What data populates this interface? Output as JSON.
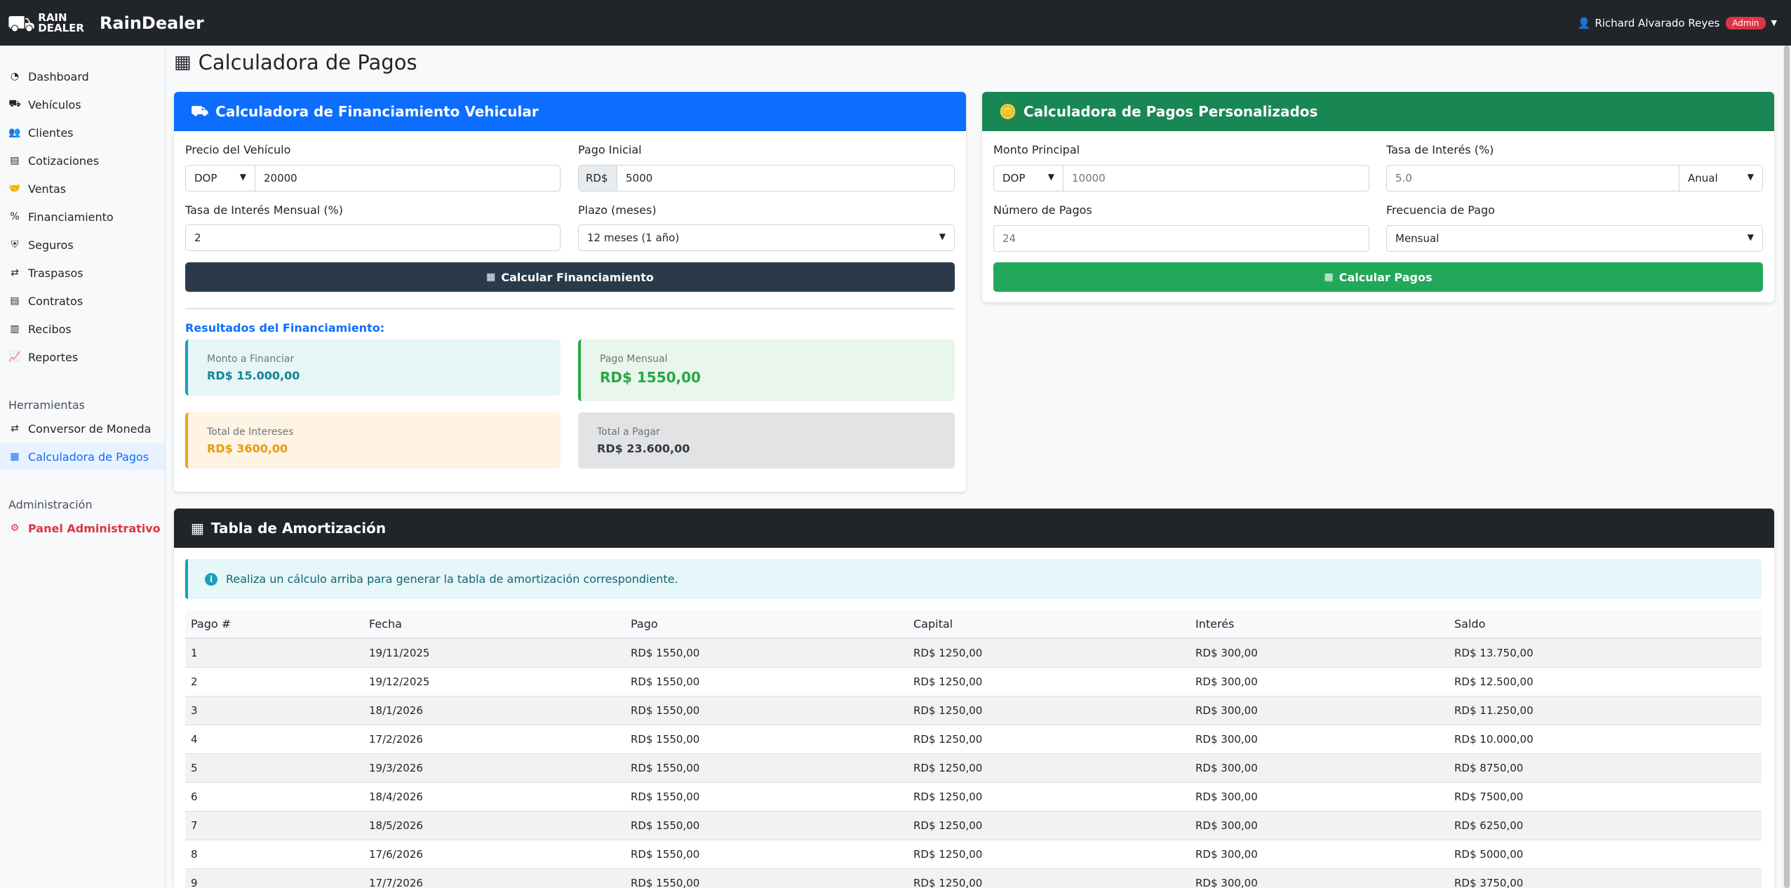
{
  "brand": {
    "logo_line1": "RAIN",
    "logo_line2": "DEALER",
    "name": "RainDealer"
  },
  "user": {
    "name": "Richard Alvarado Reyes",
    "badge": "Admin"
  },
  "sidebar": {
    "items": [
      {
        "label": "Dashboard",
        "icon": "gauge-icon"
      },
      {
        "label": "Vehículos",
        "icon": "car-icon"
      },
      {
        "label": "Clientes",
        "icon": "users-icon"
      },
      {
        "label": "Cotizaciones",
        "icon": "file-invoice-icon"
      },
      {
        "label": "Ventas",
        "icon": "handshake-icon"
      },
      {
        "label": "Financiamiento",
        "icon": "percent-icon"
      },
      {
        "label": "Seguros",
        "icon": "shield-icon"
      },
      {
        "label": "Traspasos",
        "icon": "exchange-icon"
      },
      {
        "label": "Contratos",
        "icon": "file-contract-icon"
      },
      {
        "label": "Recibos",
        "icon": "receipt-icon"
      },
      {
        "label": "Reportes",
        "icon": "chart-line-icon"
      }
    ],
    "tools_title": "Herramientas",
    "tools": [
      {
        "label": "Conversor de Moneda",
        "icon": "exchange-icon"
      },
      {
        "label": "Calculadora de Pagos",
        "icon": "calculator-icon"
      }
    ],
    "admin_title": "Administración",
    "admin": {
      "label": "Panel Administrativo",
      "icon": "user-gear-icon"
    }
  },
  "page": {
    "title": "Calculadora de Pagos"
  },
  "vehicle_calc": {
    "header": "Calculadora de Financiamiento Vehicular",
    "price_label": "Precio del Vehículo",
    "currency": "DOP",
    "price_value": "20000",
    "down_label": "Pago Inicial",
    "down_addon": "RD$",
    "down_value": "5000",
    "rate_label": "Tasa de Interés Mensual (%)",
    "rate_value": "2",
    "term_label": "Plazo (meses)",
    "term_value": "12 meses (1 año)",
    "button": "Calcular Financiamiento",
    "results_title": "Resultados del Financiamiento:",
    "results": {
      "amount_label": "Monto a Financiar",
      "amount_value": "RD$ 15.000,00",
      "monthly_label": "Pago Mensual",
      "monthly_value": "RD$ 1550,00",
      "interest_label": "Total de Intereses",
      "interest_value": "RD$ 3600,00",
      "total_label": "Total a Pagar",
      "total_value": "RD$ 23.600,00"
    }
  },
  "custom_calc": {
    "header": "Calculadora de Pagos Personalizados",
    "principal_label": "Monto Principal",
    "currency": "DOP",
    "principal_placeholder": "10000",
    "rate_label": "Tasa de Interés (%)",
    "rate_placeholder": "5.0",
    "rate_period": "Anual",
    "num_label": "Número de Pagos",
    "num_placeholder": "24",
    "freq_label": "Frecuencia de Pago",
    "freq_value": "Mensual",
    "button": "Calcular Pagos"
  },
  "amortization": {
    "header": "Tabla de Amortización",
    "alert": "Realiza un cálculo arriba para generar la tabla de amortización correspondiente.",
    "columns": [
      "Pago #",
      "Fecha",
      "Pago",
      "Capital",
      "Interés",
      "Saldo"
    ],
    "rows": [
      [
        "1",
        "19/11/2025",
        "RD$ 1550,00",
        "RD$ 1250,00",
        "RD$ 300,00",
        "RD$ 13.750,00"
      ],
      [
        "2",
        "19/12/2025",
        "RD$ 1550,00",
        "RD$ 1250,00",
        "RD$ 300,00",
        "RD$ 12.500,00"
      ],
      [
        "3",
        "18/1/2026",
        "RD$ 1550,00",
        "RD$ 1250,00",
        "RD$ 300,00",
        "RD$ 11.250,00"
      ],
      [
        "4",
        "17/2/2026",
        "RD$ 1550,00",
        "RD$ 1250,00",
        "RD$ 300,00",
        "RD$ 10.000,00"
      ],
      [
        "5",
        "19/3/2026",
        "RD$ 1550,00",
        "RD$ 1250,00",
        "RD$ 300,00",
        "RD$ 8750,00"
      ],
      [
        "6",
        "18/4/2026",
        "RD$ 1550,00",
        "RD$ 1250,00",
        "RD$ 300,00",
        "RD$ 7500,00"
      ],
      [
        "7",
        "18/5/2026",
        "RD$ 1550,00",
        "RD$ 1250,00",
        "RD$ 300,00",
        "RD$ 6250,00"
      ],
      [
        "8",
        "17/6/2026",
        "RD$ 1550,00",
        "RD$ 1250,00",
        "RD$ 300,00",
        "RD$ 5000,00"
      ],
      [
        "9",
        "17/7/2026",
        "RD$ 1550,00",
        "RD$ 1250,00",
        "RD$ 300,00",
        "RD$ 3750,00"
      ]
    ]
  }
}
